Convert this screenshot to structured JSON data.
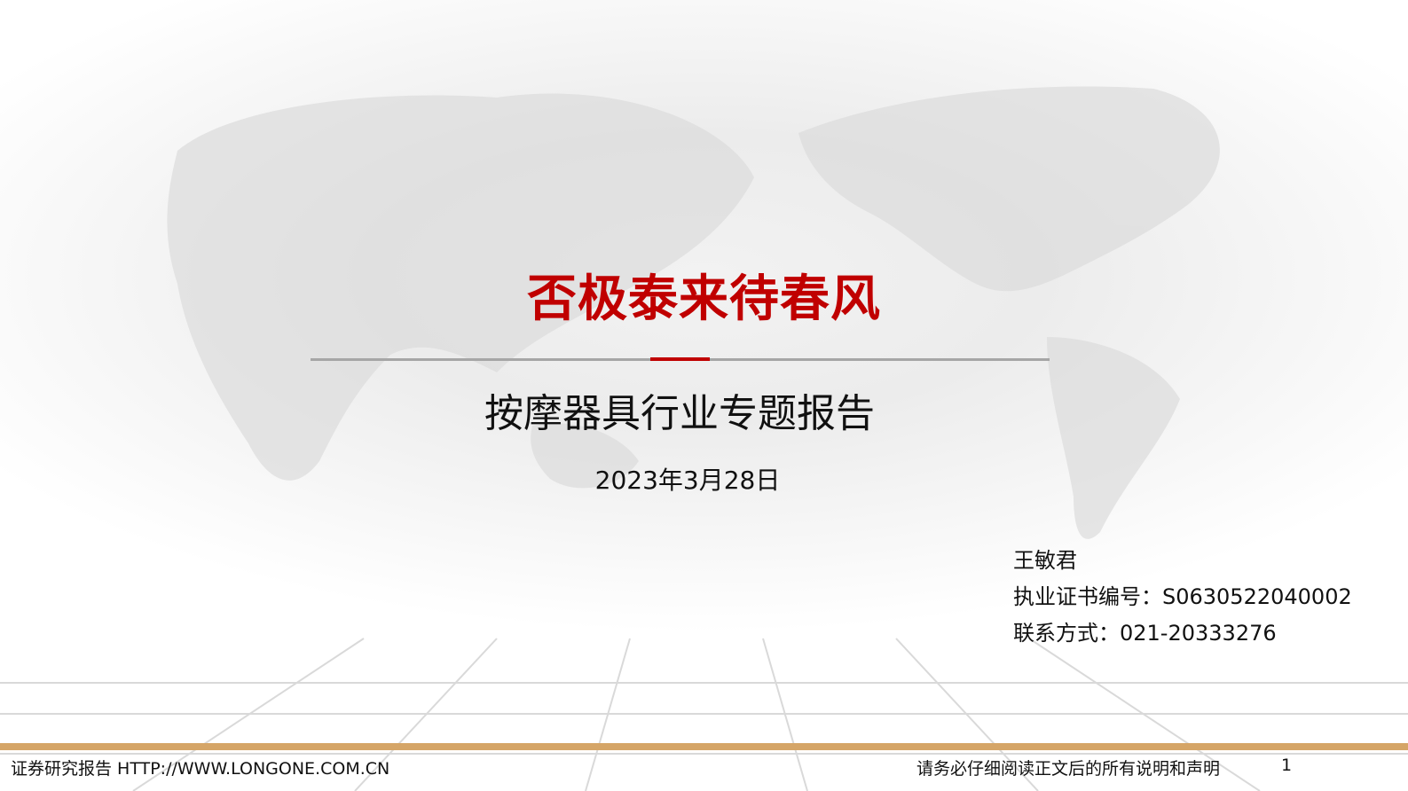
{
  "title": "否极泰来待春风",
  "subtitle": "按摩器具行业专题报告",
  "date": "2023年3月28日",
  "author": {
    "name": "王敏君",
    "license": "执业证书编号：S0630522040002",
    "contact": "联系方式：021-20333276"
  },
  "footer": {
    "left": "证券研究报告 HTTP://WWW.LONGONE.COM.CN",
    "right": "请务必仔细阅读正文后的所有说明和声明",
    "page": "1"
  },
  "colors": {
    "accent": "#c00000",
    "bar": "#d5a567"
  }
}
